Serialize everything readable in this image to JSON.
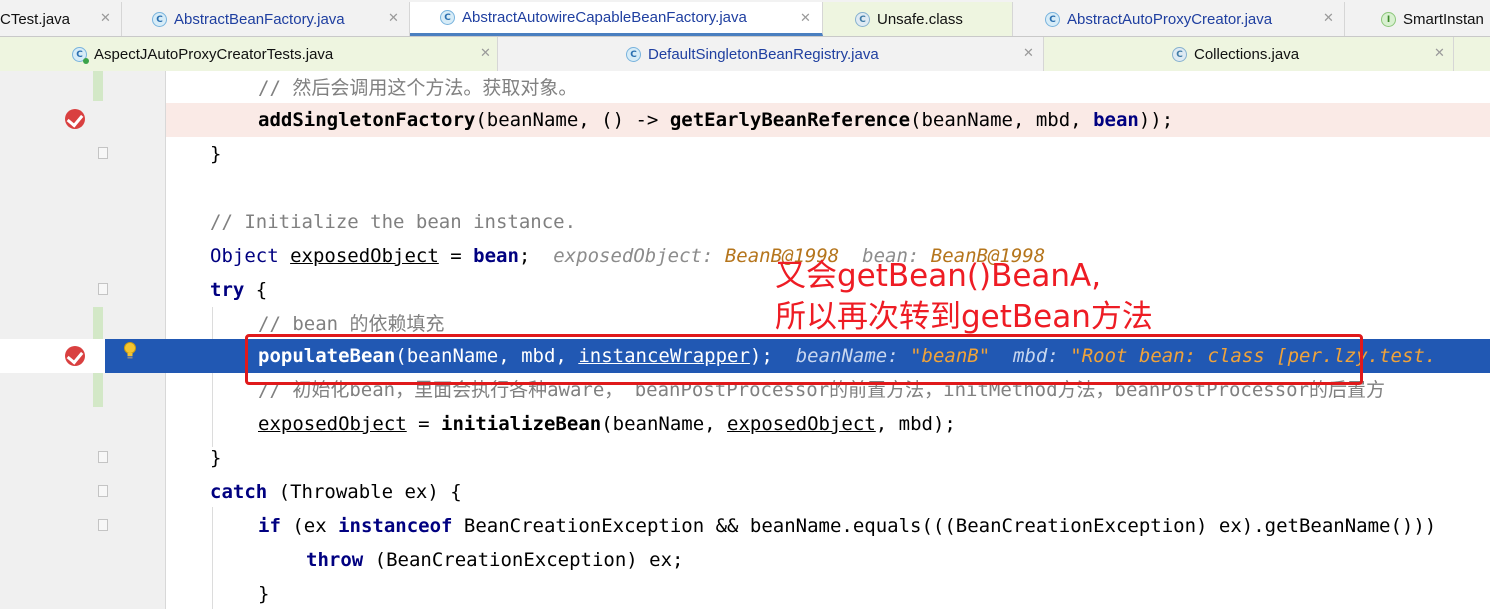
{
  "tabs_row1": [
    {
      "label": "CTest.java",
      "icon": "class-icon",
      "active": false
    },
    {
      "label": "AbstractBeanFactory.java",
      "icon": "class-icon",
      "active": false
    },
    {
      "label": "AbstractAutowireCapableBeanFactory.java",
      "icon": "class-icon",
      "active": true
    },
    {
      "label": "Unsafe.class",
      "icon": "compiled-class-icon",
      "active": false
    },
    {
      "label": "AbstractAutoProxyCreator.java",
      "icon": "class-icon",
      "active": false
    },
    {
      "label": "SmartInstan",
      "icon": "interface-icon",
      "active": false
    }
  ],
  "tabs_row2": [
    {
      "label": "AspectJAutoProxyCreatorTests.java",
      "icon": "test-class-icon"
    },
    {
      "label": "DefaultSingletonBeanRegistry.java",
      "icon": "class-icon"
    },
    {
      "label": "Collections.java",
      "icon": "compiled-class-icon"
    }
  ],
  "code": {
    "l1_comment": "// 然后会调用这个方法。获取对象。",
    "l2_fn": "addSingletonFactory",
    "l2_p1": "(beanName, () -> ",
    "l2_fn2": "getEarlyBeanReference",
    "l2_args": "(beanName, mbd, ",
    "l2_bean": "bean",
    "l2_end": "));",
    "l3": "}",
    "l5_comment": "// Initialize the bean instance.",
    "l6_type": "Object",
    "l6_var": "exposedObject",
    "l6_eq": " = ",
    "l6_bean": "bean",
    "l6_semi": ";",
    "l6_hint1_name": "exposedObject: ",
    "l6_hint1_val": "BeanB@1998",
    "l6_hint2_name": "bean: ",
    "l6_hint2_val": "BeanB@1998",
    "l7_try": "try",
    "l7_brace": " {",
    "l8_comment": "// bean 的依赖填充",
    "l9_fn": "populateBean",
    "l9_args": "(beanName, mbd, ",
    "l9_arg3": "instanceWrapper",
    "l9_end": ");",
    "l9_hint1_name": "beanName: ",
    "l9_hint1_val": "\"beanB\"",
    "l9_hint2_name": "mbd: ",
    "l9_hint2_val": "\"Root bean: class [per.lzy.test.",
    "l10_comment": "// 初始化bean，里面会执行各种aware， beanPostProcessor的前置方法，initMethod方法，beanPostProcessor的后置方",
    "l11_var": "exposedObject",
    "l11_eq": " = ",
    "l11_fn": "initializeBean",
    "l11_args1": "(beanName, ",
    "l11_arg2": "exposedObject",
    "l11_end": ", mbd);",
    "l12": "}",
    "l13_catch": "catch",
    "l13_rest": " (Throwable ex) {",
    "l14_if": "if",
    "l14_p1": " (ex ",
    "l14_inst": "instanceof",
    "l14_p2": " BeanCreationException && beanName.equals(((BeanCreationException) ex).getBeanName()))",
    "l15_throw": "throw",
    "l15_rest": " (BeanCreationException) ex;",
    "l16": "}"
  },
  "annotation": {
    "line1": "又会getBean()BeanA,",
    "line2": "所以再次转到getBean方法"
  },
  "colors": {
    "current_line": "#2158b3",
    "breakpoint_line": "#faeae6",
    "annotation_red": "#ee1c24",
    "keyword": "#000080"
  }
}
